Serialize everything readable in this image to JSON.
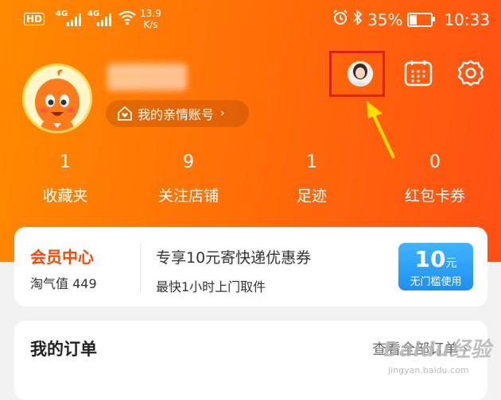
{
  "status_bar": {
    "hd": "HD",
    "sim1": "4G",
    "sim2": "4G",
    "speed_value": "13.9",
    "speed_unit": "K/s",
    "battery": "35%",
    "time": "10:33"
  },
  "profile": {
    "family_account_label": "我的亲情账号",
    "chevron": "›"
  },
  "stats": [
    {
      "count": "1",
      "label": "收藏夹"
    },
    {
      "count": "9",
      "label": "关注店铺"
    },
    {
      "count": "1",
      "label": "足迹"
    },
    {
      "count": "0",
      "label": "红包卡券"
    }
  ],
  "member": {
    "title": "会员中心",
    "points": "淘气值 449",
    "promo_title": "专享10元寄快递优惠券",
    "promo_sub": "最快1小时上门取件",
    "coupon_amount": "10",
    "coupon_unit": "元",
    "coupon_text": "无门槛使用"
  },
  "orders": {
    "title": "我的订单",
    "view_all": "查看全部订单 ›"
  },
  "watermark": {
    "text": "Baidu经验",
    "url": "jingyan.baidu.com"
  },
  "colors": {
    "header_start": "#ff8a00",
    "header_end": "#ff4f14",
    "member_accent": "#ff4400",
    "highlight_box": "#e02020",
    "arrow": "#ffe000",
    "coupon": "#1e8ff0"
  }
}
